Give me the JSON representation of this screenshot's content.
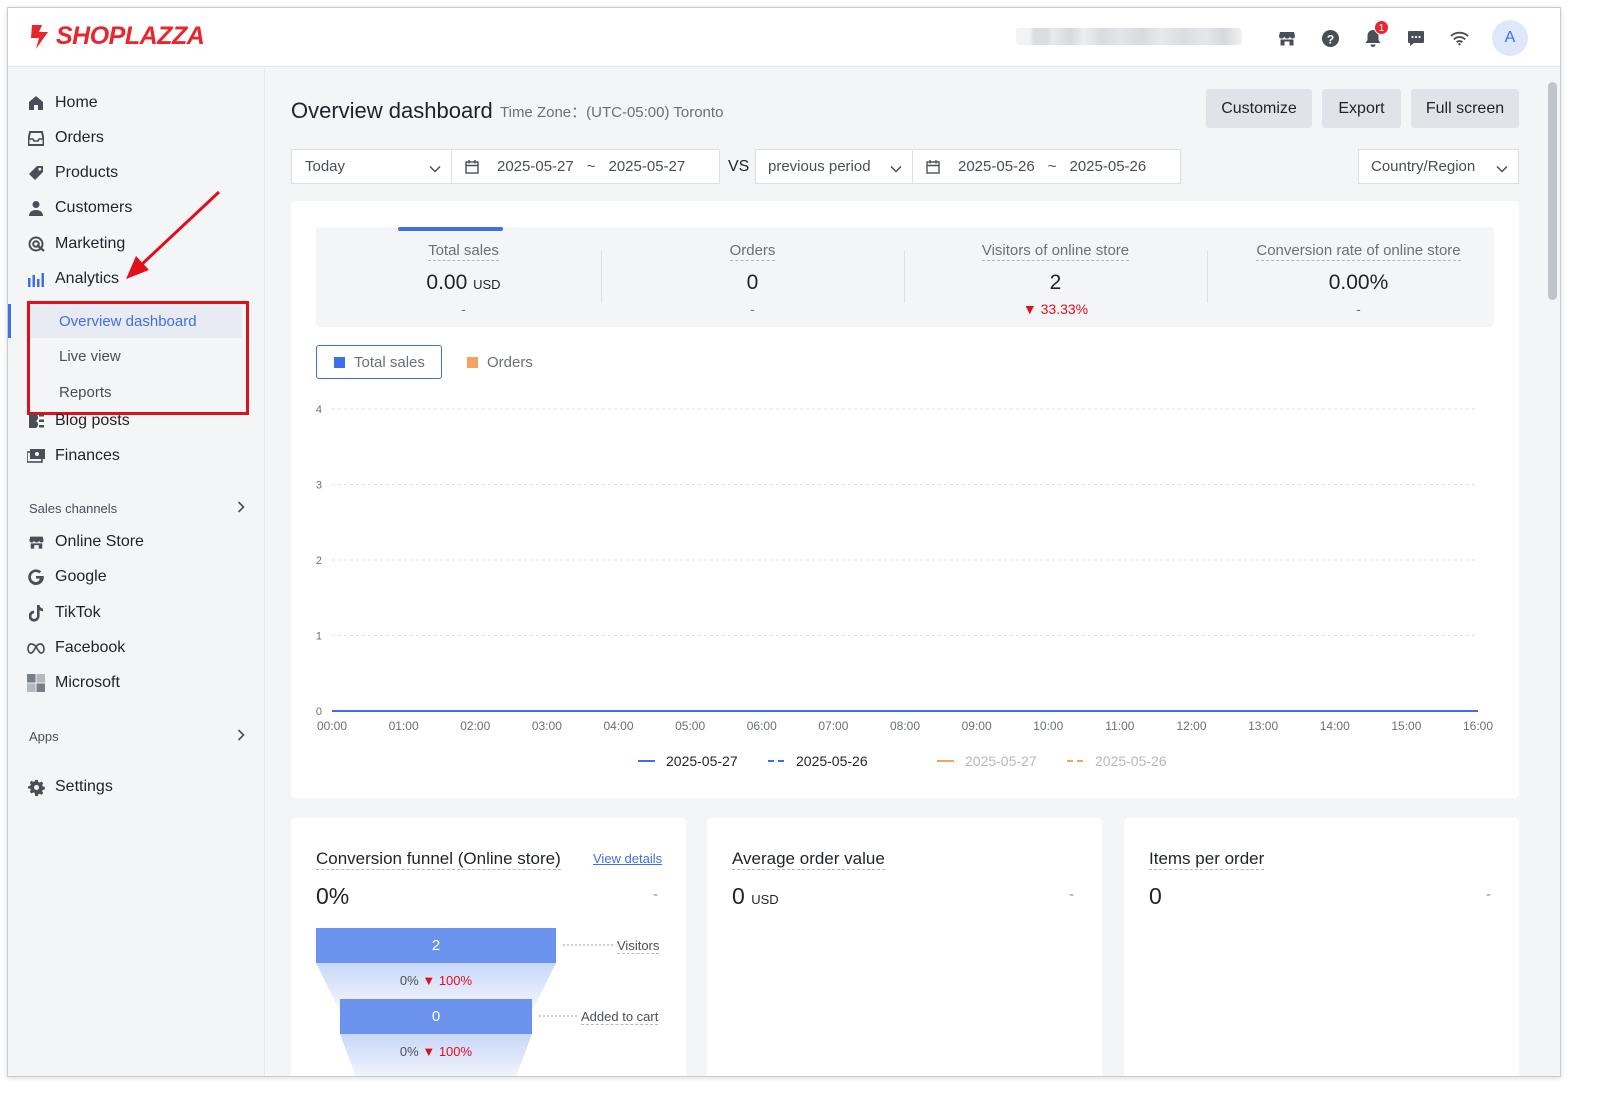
{
  "brand": {
    "name": "SHOPLAZZA",
    "color": "#e8262d"
  },
  "topbar": {
    "icons": [
      "store-icon",
      "help-icon",
      "bell-icon",
      "chat-icon",
      "wifi-icon"
    ],
    "notification_count": "1",
    "avatar_initial": "A"
  },
  "sidebar": {
    "items": [
      {
        "label": "Home",
        "icon": "home-icon"
      },
      {
        "label": "Orders",
        "icon": "inbox-icon"
      },
      {
        "label": "Products",
        "icon": "tag-icon"
      },
      {
        "label": "Customers",
        "icon": "person-icon"
      },
      {
        "label": "Marketing",
        "icon": "target-icon"
      },
      {
        "label": "Analytics",
        "icon": "bar-chart-icon"
      }
    ],
    "analytics_sub": [
      {
        "label": "Overview dashboard",
        "active": true
      },
      {
        "label": "Live view"
      },
      {
        "label": "Reports"
      }
    ],
    "items2": [
      {
        "label": "Blog posts",
        "icon": "blog-icon"
      },
      {
        "label": "Finances",
        "icon": "finance-icon"
      }
    ],
    "sales_channels_label": "Sales channels",
    "channels": [
      {
        "label": "Online Store",
        "icon": "store-icon"
      },
      {
        "label": "Google",
        "icon": "google-icon"
      },
      {
        "label": "TikTok",
        "icon": "tiktok-icon"
      },
      {
        "label": "Facebook",
        "icon": "meta-icon"
      },
      {
        "label": "Microsoft",
        "icon": "microsoft-icon"
      }
    ],
    "apps_label": "Apps",
    "settings_label": "Settings"
  },
  "header": {
    "title": "Overview dashboard",
    "timezone": "Time Zone：(UTC-05:00) Toronto",
    "buttons": {
      "customize": "Customize",
      "export": "Export",
      "fullscreen": "Full screen"
    }
  },
  "filters": {
    "period": "Today",
    "date_from": "2025-05-27",
    "date_sep": "~",
    "date_to": "2025-05-27",
    "vs": "VS",
    "compare": "previous period",
    "cmp_from": "2025-05-26",
    "cmp_to": "2025-05-26",
    "region": "Country/Region"
  },
  "kpis": [
    {
      "label": "Total sales",
      "value": "0.00",
      "unit": "USD",
      "sub": "-"
    },
    {
      "label": "Orders",
      "value": "0",
      "unit": "",
      "sub": "-"
    },
    {
      "label": "Visitors of online store",
      "value": "2",
      "unit": "",
      "sub": "▼ 33.33%",
      "down": true
    },
    {
      "label": "Conversion rate of online store",
      "value": "0.00%",
      "unit": "",
      "sub": "-"
    }
  ],
  "chart_tabs": [
    {
      "label": "Total sales",
      "color": "#3e6fe8",
      "selected": true
    },
    {
      "label": "Orders",
      "color": "#f4a261"
    }
  ],
  "chart_data": {
    "type": "line",
    "x": [
      "00:00",
      "01:00",
      "02:00",
      "03:00",
      "04:00",
      "05:00",
      "06:00",
      "07:00",
      "08:00",
      "09:00",
      "10:00",
      "11:00",
      "12:00",
      "13:00",
      "14:00",
      "15:00",
      "16:00"
    ],
    "ylim": [
      0,
      4
    ],
    "yticks": [
      "4",
      "3",
      "2",
      "1",
      "0"
    ],
    "grid": true,
    "series": [
      {
        "name": "2025-05-27",
        "values": [
          0,
          0,
          0,
          0,
          0,
          0,
          0,
          0,
          0,
          0,
          0,
          0,
          0,
          0,
          0,
          0,
          0
        ],
        "color": "#3e6fe8",
        "dash": false
      },
      {
        "name": "2025-05-26",
        "values": [
          0,
          0,
          0,
          0,
          0,
          0,
          0,
          0,
          0,
          0,
          0,
          0,
          0,
          0,
          0,
          0,
          0
        ],
        "color": "#3e6fe8",
        "dash": true
      }
    ],
    "legend": [
      {
        "name": "2025-05-27",
        "color": "#3e6fe8",
        "dash": false,
        "muted": false
      },
      {
        "name": "2025-05-26",
        "color": "#3e6fe8",
        "dash": true,
        "muted": false
      },
      {
        "name": "2025-05-27",
        "color": "#f4a261",
        "dash": false,
        "muted": true
      },
      {
        "name": "2025-05-26",
        "color": "#f4a261",
        "dash": true,
        "muted": true
      }
    ],
    "legend_position": "bottom"
  },
  "funnel": {
    "title": "Conversion funnel (Online store)",
    "link": "View details",
    "value": "0%",
    "dash": "-",
    "steps": [
      {
        "value": "2",
        "label": "Visitors"
      },
      {
        "value": "0",
        "label": "Added to cart"
      }
    ],
    "gaps": [
      {
        "rate": "0%",
        "change": "100%"
      },
      {
        "rate": "0%",
        "change": "100%"
      }
    ]
  },
  "aov": {
    "title": "Average order value",
    "value": "0",
    "unit": "USD",
    "dash": "-"
  },
  "ipo": {
    "title": "Items per order",
    "value": "0",
    "dash": "-"
  }
}
